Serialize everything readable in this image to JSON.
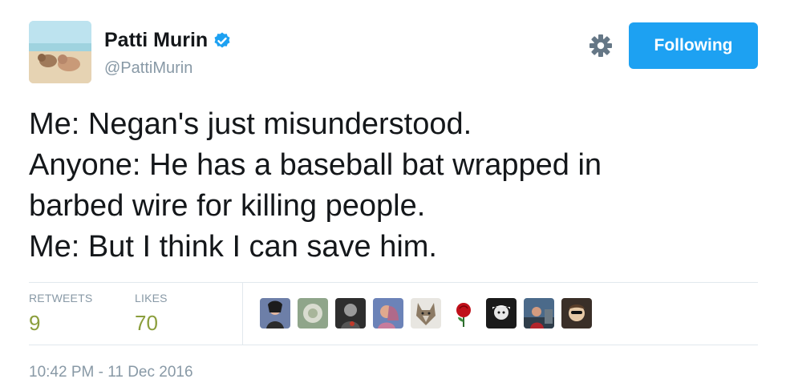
{
  "author": {
    "name": "Patti Murin",
    "handle": "@PattiMurin",
    "avatar_icon": "avatar-beach-pigs",
    "verified_icon": "verified-badge-icon"
  },
  "actions": {
    "settings_icon": "gear-icon",
    "follow_label": "Following",
    "follow_color": "#1da1f2"
  },
  "tweet": {
    "lines": [
      "Me: Negan's just misunderstood.",
      "Anyone: He has a baseball bat wrapped in",
      "barbed wire for killing people.",
      "Me: But I think I can save him."
    ]
  },
  "stats": {
    "retweets_label": "RETWEETS",
    "retweets_value": "9",
    "likes_label": "LIKES",
    "likes_value": "70",
    "value_color": "#8b9e3c"
  },
  "likers": [
    {
      "icon": "liker-avatar-1"
    },
    {
      "icon": "liker-avatar-2"
    },
    {
      "icon": "liker-avatar-3"
    },
    {
      "icon": "liker-avatar-4"
    },
    {
      "icon": "liker-avatar-5"
    },
    {
      "icon": "liker-avatar-6"
    },
    {
      "icon": "liker-avatar-7"
    },
    {
      "icon": "liker-avatar-8"
    },
    {
      "icon": "liker-avatar-9"
    }
  ],
  "timestamp": "10:42 PM - 11 Dec 2016"
}
